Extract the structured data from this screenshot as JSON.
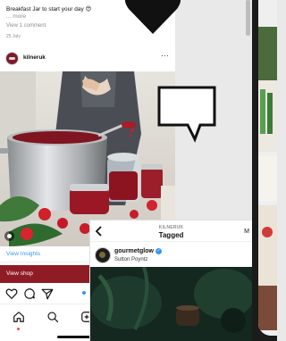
{
  "post": {
    "caption": "Breakfast Jar to start your day 😍",
    "more": "... more",
    "view_comment": "View 1 comment",
    "date": "25 July",
    "username": "kilneruk",
    "more_glyph": "···"
  },
  "cta": {
    "insights": "View Insights",
    "shop": "View shop"
  },
  "tagged": {
    "account": "KILNERUK",
    "title": "Tagged",
    "edge_letter": "M",
    "username": "gourmetglow",
    "location": "Sutton Poyntz",
    "verified_glyph": "✓"
  },
  "colors": {
    "link_blue": "#3897f0",
    "shop_red": "#8f1c25",
    "notification_red": "#ed4956"
  },
  "icons": [
    "heart-icon",
    "comment-icon",
    "share-icon",
    "home-icon",
    "search-icon",
    "add-icon",
    "back-chevron-icon",
    "verified-icon"
  ]
}
